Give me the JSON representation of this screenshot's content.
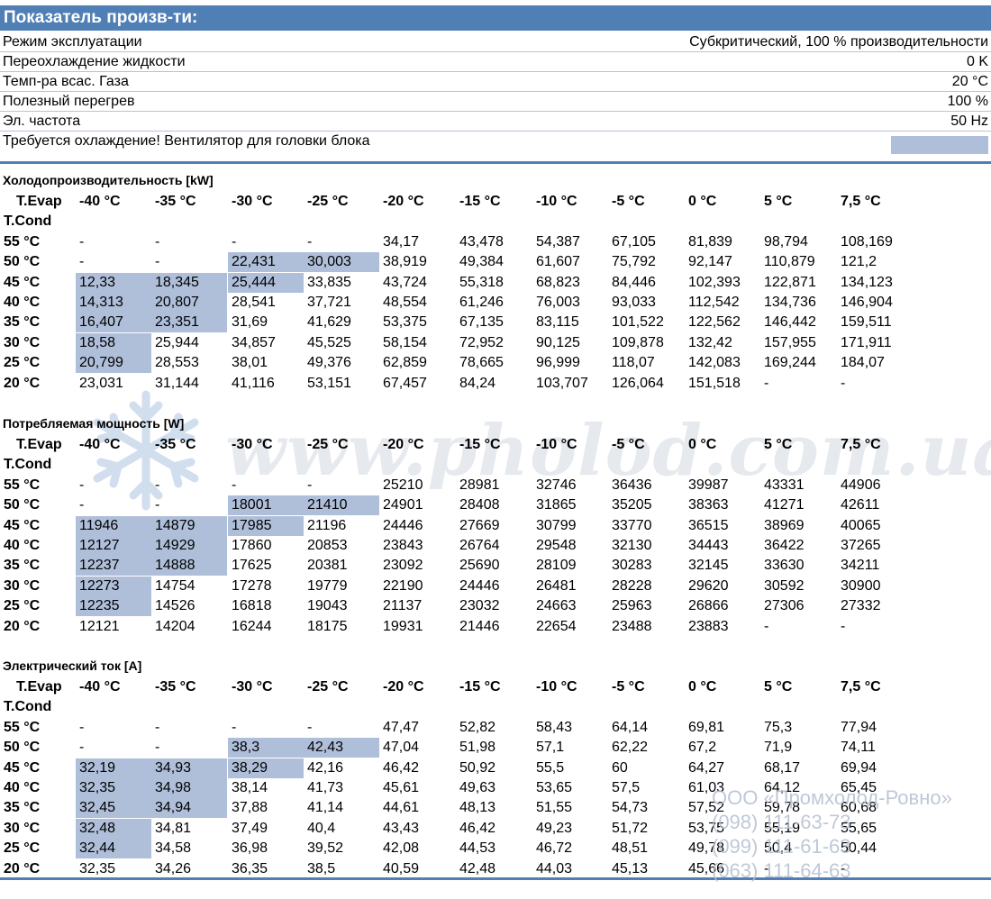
{
  "header": {
    "title": "Показатель произв-ти:"
  },
  "info_rows": [
    {
      "label": "Режим эксплуатации",
      "value": "Субкритический, 100 % производительности"
    },
    {
      "label": "Переохлаждение жидкости",
      "value": "0 K"
    },
    {
      "label": "Темп-ра всас. Газа",
      "value": "20 °C"
    },
    {
      "label": "Полезный перегрев",
      "value": "100 %"
    },
    {
      "label": "Эл. частота",
      "value": "50 Hz"
    }
  ],
  "warning": {
    "text": "Требуется охлаждение! Вентилятор для головки блока",
    "color": "#afbfda"
  },
  "colors": {
    "accent": "#4f7fb4",
    "highlight": "#afbfda"
  },
  "table_labels": {
    "evap": "T.Evap",
    "cond": "T.Cond"
  },
  "evap_temps": [
    "-40 °C",
    "-35 °C",
    "-30 °C",
    "-25 °C",
    "-20 °C",
    "-15 °C",
    "-10 °C",
    "-5 °C",
    "0 °C",
    "5 °C",
    "7,5 °C"
  ],
  "cond_temps": [
    "55 °C",
    "50 °C",
    "45 °C",
    "40 °C",
    "35 °C",
    "30 °C",
    "25 °C",
    "20 °C"
  ],
  "tables": [
    {
      "title": "Холодопроизводительность [kW]",
      "rows": [
        [
          "-",
          "-",
          "-",
          "-",
          "34,17",
          "43,478",
          "54,387",
          "67,105",
          "81,839",
          "98,794",
          "108,169"
        ],
        [
          "-",
          "-",
          "22,431",
          "30,003",
          "38,919",
          "49,384",
          "61,607",
          "75,792",
          "92,147",
          "110,879",
          "121,2"
        ],
        [
          "12,33",
          "18,345",
          "25,444",
          "33,835",
          "43,724",
          "55,318",
          "68,823",
          "84,446",
          "102,393",
          "122,871",
          "134,123"
        ],
        [
          "14,313",
          "20,807",
          "28,541",
          "37,721",
          "48,554",
          "61,246",
          "76,003",
          "93,033",
          "112,542",
          "134,736",
          "146,904"
        ],
        [
          "16,407",
          "23,351",
          "31,69",
          "41,629",
          "53,375",
          "67,135",
          "83,115",
          "101,522",
          "122,562",
          "146,442",
          "159,511"
        ],
        [
          "18,58",
          "25,944",
          "34,857",
          "45,525",
          "58,154",
          "72,952",
          "90,125",
          "109,878",
          "132,42",
          "157,955",
          "171,911"
        ],
        [
          "20,799",
          "28,553",
          "38,01",
          "49,376",
          "62,859",
          "78,665",
          "96,999",
          "118,07",
          "142,083",
          "169,244",
          "184,07"
        ],
        [
          "23,031",
          "31,144",
          "41,116",
          "53,151",
          "67,457",
          "84,24",
          "103,707",
          "126,064",
          "151,518",
          "-",
          "-"
        ]
      ],
      "highlight": [
        [
          1,
          2
        ],
        [
          1,
          3
        ],
        [
          2,
          0
        ],
        [
          2,
          1
        ],
        [
          2,
          2
        ],
        [
          3,
          0
        ],
        [
          3,
          1
        ],
        [
          4,
          0
        ],
        [
          4,
          1
        ],
        [
          5,
          0
        ],
        [
          6,
          0
        ]
      ]
    },
    {
      "title": "Потребляемая мощность [W]",
      "rows": [
        [
          "-",
          "-",
          "-",
          "-",
          "25210",
          "28981",
          "32746",
          "36436",
          "39987",
          "43331",
          "44906"
        ],
        [
          "-",
          "-",
          "18001",
          "21410",
          "24901",
          "28408",
          "31865",
          "35205",
          "38363",
          "41271",
          "42611"
        ],
        [
          "11946",
          "14879",
          "17985",
          "21196",
          "24446",
          "27669",
          "30799",
          "33770",
          "36515",
          "38969",
          "40065"
        ],
        [
          "12127",
          "14929",
          "17860",
          "20853",
          "23843",
          "26764",
          "29548",
          "32130",
          "34443",
          "36422",
          "37265"
        ],
        [
          "12237",
          "14888",
          "17625",
          "20381",
          "23092",
          "25690",
          "28109",
          "30283",
          "32145",
          "33630",
          "34211"
        ],
        [
          "12273",
          "14754",
          "17278",
          "19779",
          "22190",
          "24446",
          "26481",
          "28228",
          "29620",
          "30592",
          "30900"
        ],
        [
          "12235",
          "14526",
          "16818",
          "19043",
          "21137",
          "23032",
          "24663",
          "25963",
          "26866",
          "27306",
          "27332"
        ],
        [
          "12121",
          "14204",
          "16244",
          "18175",
          "19931",
          "21446",
          "22654",
          "23488",
          "23883",
          "-",
          "-"
        ]
      ],
      "highlight": [
        [
          1,
          2
        ],
        [
          1,
          3
        ],
        [
          2,
          0
        ],
        [
          2,
          1
        ],
        [
          2,
          2
        ],
        [
          3,
          0
        ],
        [
          3,
          1
        ],
        [
          4,
          0
        ],
        [
          4,
          1
        ],
        [
          5,
          0
        ],
        [
          6,
          0
        ]
      ]
    },
    {
      "title": "Электрический ток [A]",
      "rows": [
        [
          "-",
          "-",
          "-",
          "-",
          "47,47",
          "52,82",
          "58,43",
          "64,14",
          "69,81",
          "75,3",
          "77,94"
        ],
        [
          "-",
          "-",
          "38,3",
          "42,43",
          "47,04",
          "51,98",
          "57,1",
          "62,22",
          "67,2",
          "71,9",
          "74,11"
        ],
        [
          "32,19",
          "34,93",
          "38,29",
          "42,16",
          "46,42",
          "50,92",
          "55,5",
          "60",
          "64,27",
          "68,17",
          "69,94"
        ],
        [
          "32,35",
          "34,98",
          "38,14",
          "41,73",
          "45,61",
          "49,63",
          "53,65",
          "57,5",
          "61,03",
          "64,12",
          "65,45"
        ],
        [
          "32,45",
          "34,94",
          "37,88",
          "41,14",
          "44,61",
          "48,13",
          "51,55",
          "54,73",
          "57,52",
          "59,78",
          "60,68"
        ],
        [
          "32,48",
          "34,81",
          "37,49",
          "40,4",
          "43,43",
          "46,42",
          "49,23",
          "51,72",
          "53,75",
          "55,19",
          "55,65"
        ],
        [
          "32,44",
          "34,58",
          "36,98",
          "39,52",
          "42,08",
          "44,53",
          "46,72",
          "48,51",
          "49,78",
          "50,4",
          "50,44"
        ],
        [
          "32,35",
          "34,26",
          "36,35",
          "38,5",
          "40,59",
          "42,48",
          "44,03",
          "45,13",
          "45,66",
          "-",
          "-"
        ]
      ],
      "highlight": [
        [
          1,
          2
        ],
        [
          1,
          3
        ],
        [
          2,
          0
        ],
        [
          2,
          1
        ],
        [
          2,
          2
        ],
        [
          3,
          0
        ],
        [
          3,
          1
        ],
        [
          4,
          0
        ],
        [
          4,
          1
        ],
        [
          5,
          0
        ],
        [
          6,
          0
        ]
      ]
    }
  ],
  "watermark": {
    "text": "www.pholod.com.ua"
  },
  "contact": {
    "company": "ООО «Промхолод-Ровно»",
    "phones": [
      "(098) 111-63-73",
      "(099) 111-61-63",
      "(063) 111-64-63"
    ]
  }
}
